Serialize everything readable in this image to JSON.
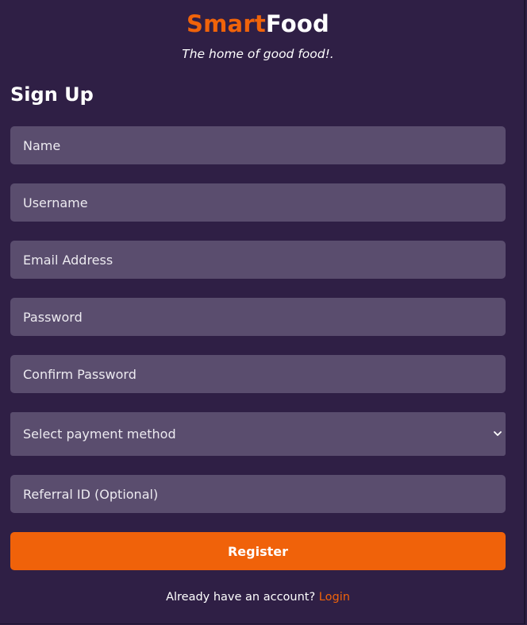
{
  "brand": {
    "part1": "Smart",
    "part2": "Food",
    "tagline": "The home of good food!."
  },
  "form": {
    "title": "Sign Up",
    "fields": [
      {
        "placeholder": "Name"
      },
      {
        "placeholder": "Username"
      },
      {
        "placeholder": "Email Address"
      },
      {
        "placeholder": "Password"
      },
      {
        "placeholder": "Confirm Password"
      }
    ],
    "payment_select": {
      "selected": "Select payment method"
    },
    "referral": {
      "placeholder": "Referral ID (Optional)"
    },
    "submit_label": "Register"
  },
  "footer": {
    "text": "Already have an account?",
    "link_label": "Login"
  },
  "colors": {
    "accent": "#f0630a",
    "background": "#2f1f45",
    "field": "#5a4d6e"
  }
}
